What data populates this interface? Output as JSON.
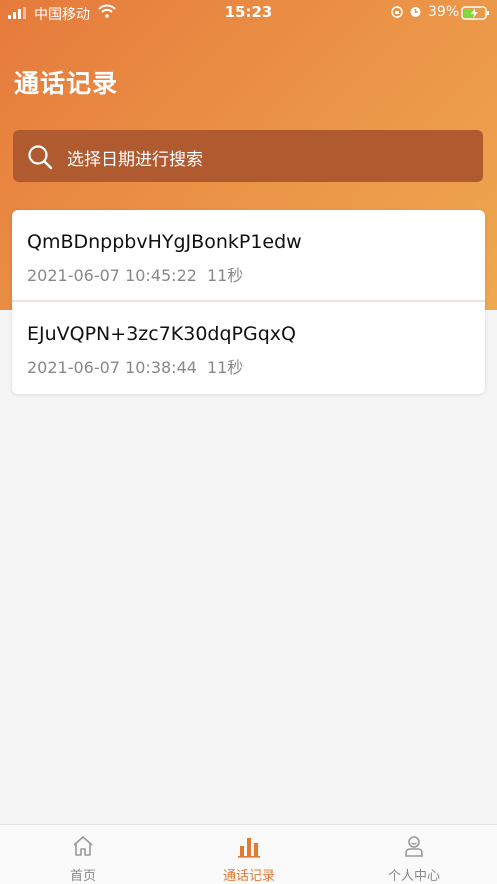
{
  "status_bar": {
    "carrier": "中国移动",
    "time": "15:23",
    "battery": "39%"
  },
  "page": {
    "title": "通话记录"
  },
  "search": {
    "placeholder": "选择日期进行搜索"
  },
  "records": [
    {
      "name": "QmBDnppbvHYgJBonkP1edw",
      "datetime": "2021-06-07 10:45:22",
      "duration": "11秒"
    },
    {
      "name": "EJuVQPN+3zc7K30dqPGqxQ",
      "datetime": "2021-06-07 10:38:44",
      "duration": "11秒"
    }
  ],
  "tabbar": {
    "items": [
      {
        "label": "首页",
        "icon": "home-icon",
        "active": false
      },
      {
        "label": "通话记录",
        "icon": "bar-chart-icon",
        "active": true
      },
      {
        "label": "个人中心",
        "icon": "user-icon",
        "active": false
      }
    ]
  },
  "colors": {
    "accent": "#e27a33",
    "header_start": "#e67a3b",
    "header_end": "#efa850",
    "search_bg": "#b05a30"
  }
}
